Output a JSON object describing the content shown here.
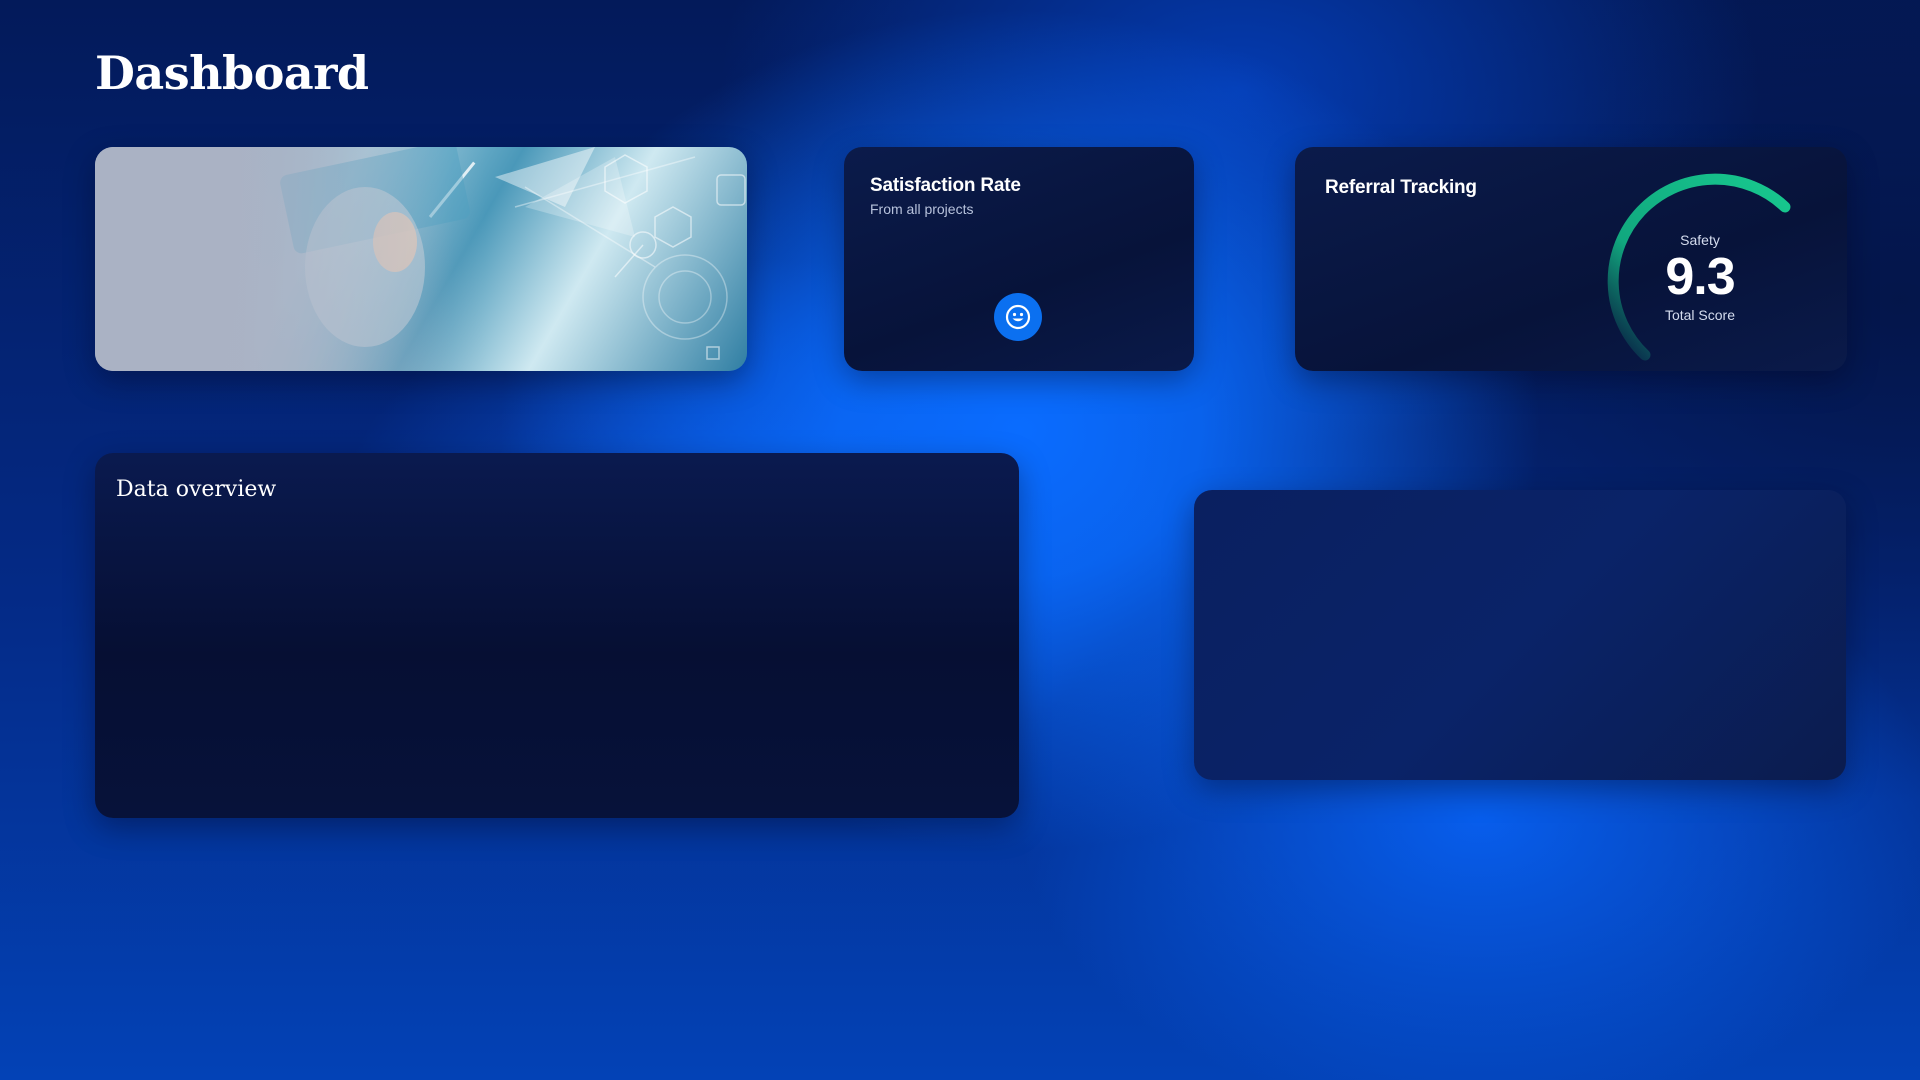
{
  "page": {
    "title": "Dashboard"
  },
  "satisfaction": {
    "title": "Satisfaction Rate",
    "subtitle": "From all projects",
    "icon": "smile-icon"
  },
  "referral": {
    "title": "Referral Tracking",
    "gauge_label": "Safety",
    "score": "9.3",
    "score_caption": "Total Score",
    "gauge_color": "#12b886"
  },
  "overview": {
    "title": "Data overview"
  },
  "colors": {
    "accent": "#0b70f0",
    "card": "#0b1b4b",
    "gauge": "#12b886"
  }
}
